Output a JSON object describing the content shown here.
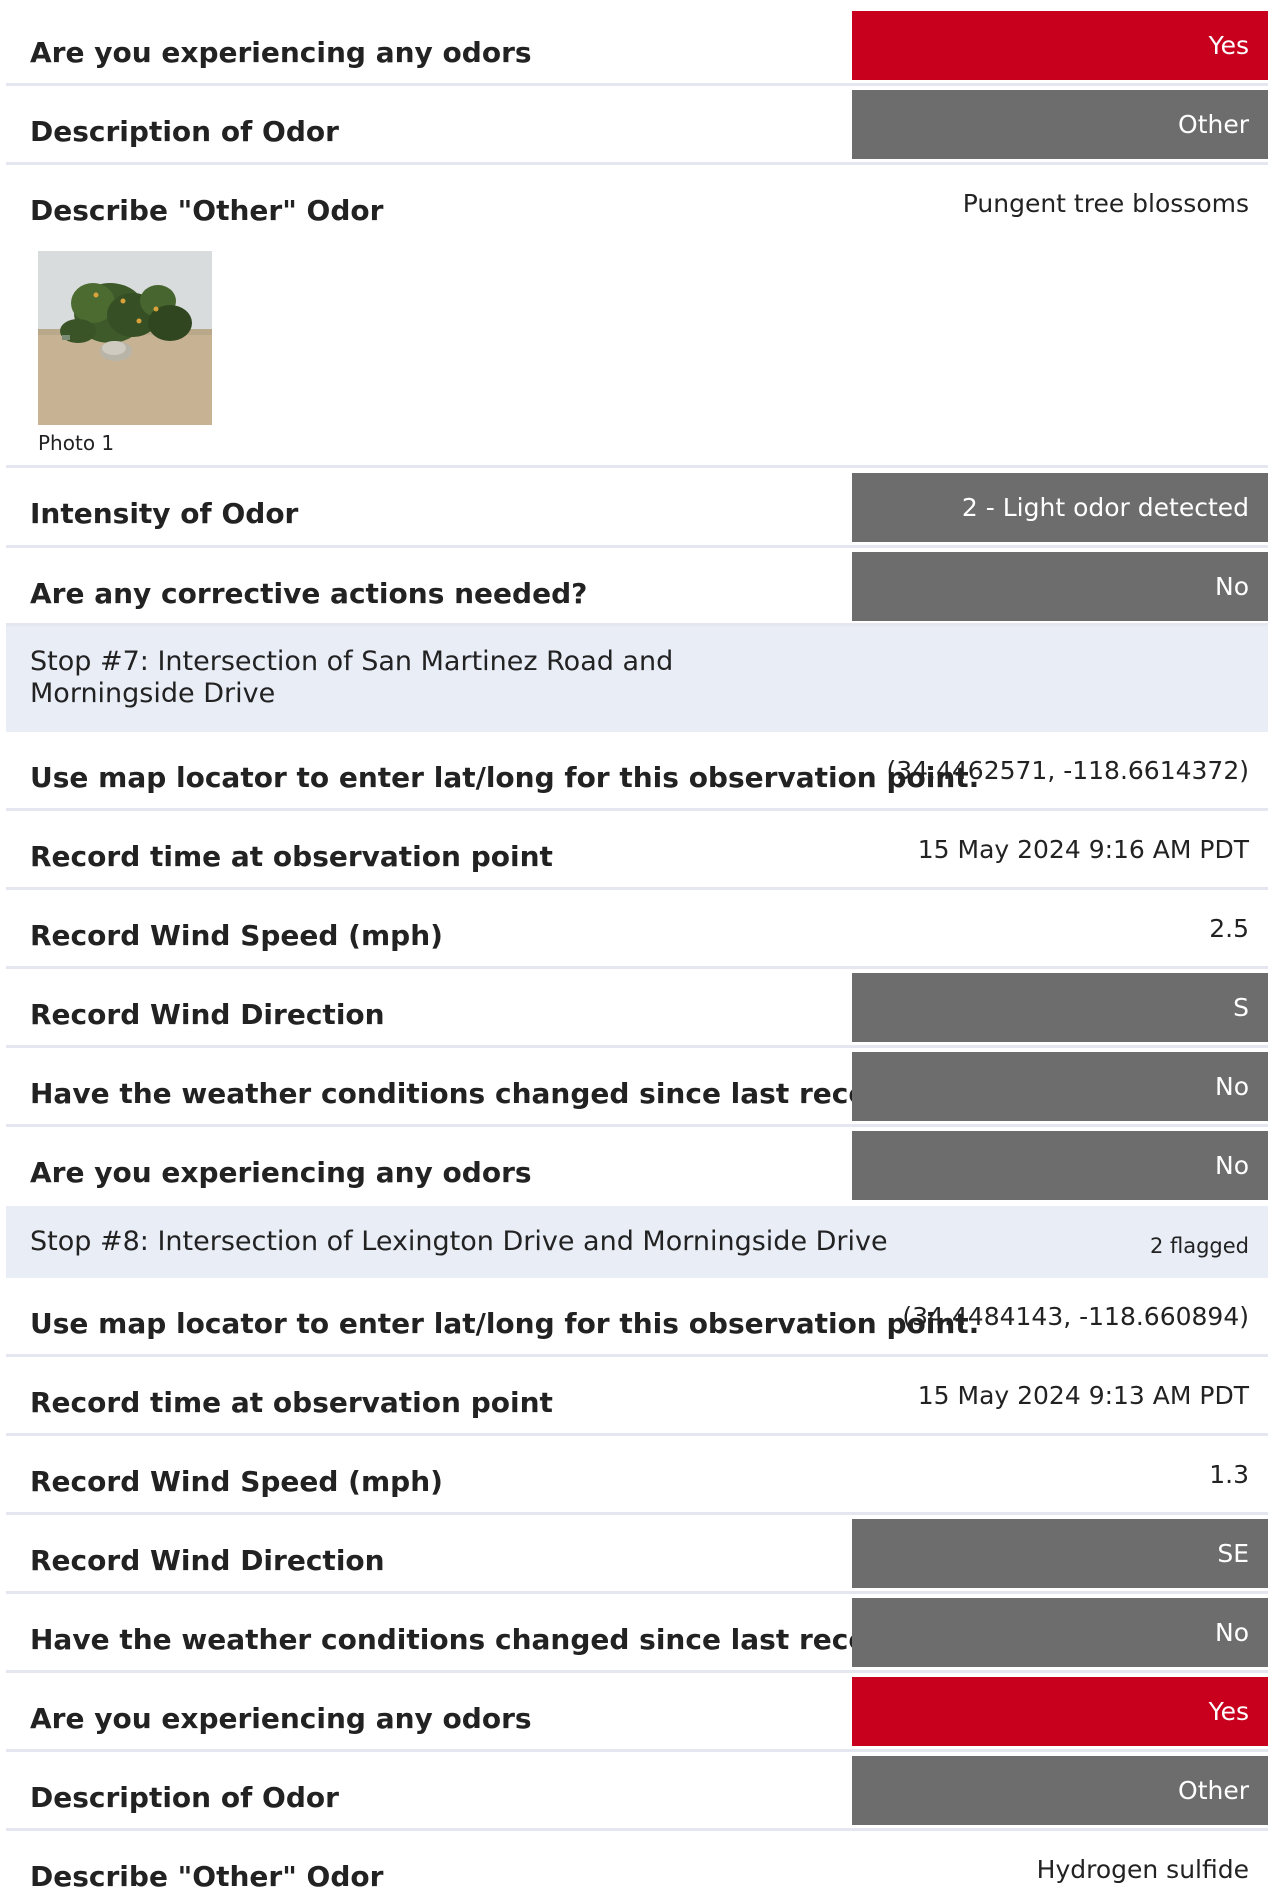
{
  "rows_top": [
    {
      "question": "Are you experiencing any odors",
      "answer": "Yes"
    },
    {
      "question": "Description of Odor",
      "answer": "Other"
    },
    {
      "question": "Describe \"Other\" Odor",
      "answer": "Pungent tree blossoms"
    }
  ],
  "photo": {
    "caption": "Photo 1"
  },
  "rows_mid": [
    {
      "question": "Intensity of Odor",
      "answer": "2 - Light odor detected"
    },
    {
      "question": "Are any corrective actions needed?",
      "answer": "No"
    }
  ],
  "stop7": {
    "title": "Stop #7: Intersection of San Martinez Road and Morningside Drive",
    "rows": [
      {
        "question": "Use map locator to enter lat/long for this observation point.",
        "answer": "(34.4462571, -118.6614372)"
      },
      {
        "question": "Record time at observation point",
        "answer": "15 May 2024 9:16 AM PDT"
      },
      {
        "question": "Record Wind Speed (mph)",
        "answer": "2.5"
      },
      {
        "question": "Record Wind Direction",
        "answer": "S"
      },
      {
        "question": "Have the weather conditions changed since last recorded?",
        "answer": "No"
      },
      {
        "question": "Are you experiencing any odors",
        "answer": "No"
      }
    ]
  },
  "stop8": {
    "title": "Stop #8: Intersection of Lexington Drive and Morningside Drive",
    "flag": "2 flagged",
    "rows": [
      {
        "question": "Use map locator to enter lat/long for this observation point.",
        "answer": "(34.4484143, -118.660894)"
      },
      {
        "question": "Record time at observation point",
        "answer": "15 May 2024 9:13 AM PDT"
      },
      {
        "question": "Record Wind Speed (mph)",
        "answer": "1.3"
      },
      {
        "question": "Record Wind Direction",
        "answer": "SE"
      },
      {
        "question": "Have the weather conditions changed since last recorded?",
        "answer": "No"
      },
      {
        "question": "Are you experiencing any odors",
        "answer": "Yes"
      },
      {
        "question": "Description of Odor",
        "answer": "Other"
      },
      {
        "question": "Describe \"Other\" Odor",
        "answer": "Hydrogen sulfide"
      }
    ]
  },
  "colors": {
    "flagged": "#c8001e",
    "selected": "#6d6d6d",
    "section_bg": "#e8edf6",
    "divider": "#e4e7ef"
  }
}
